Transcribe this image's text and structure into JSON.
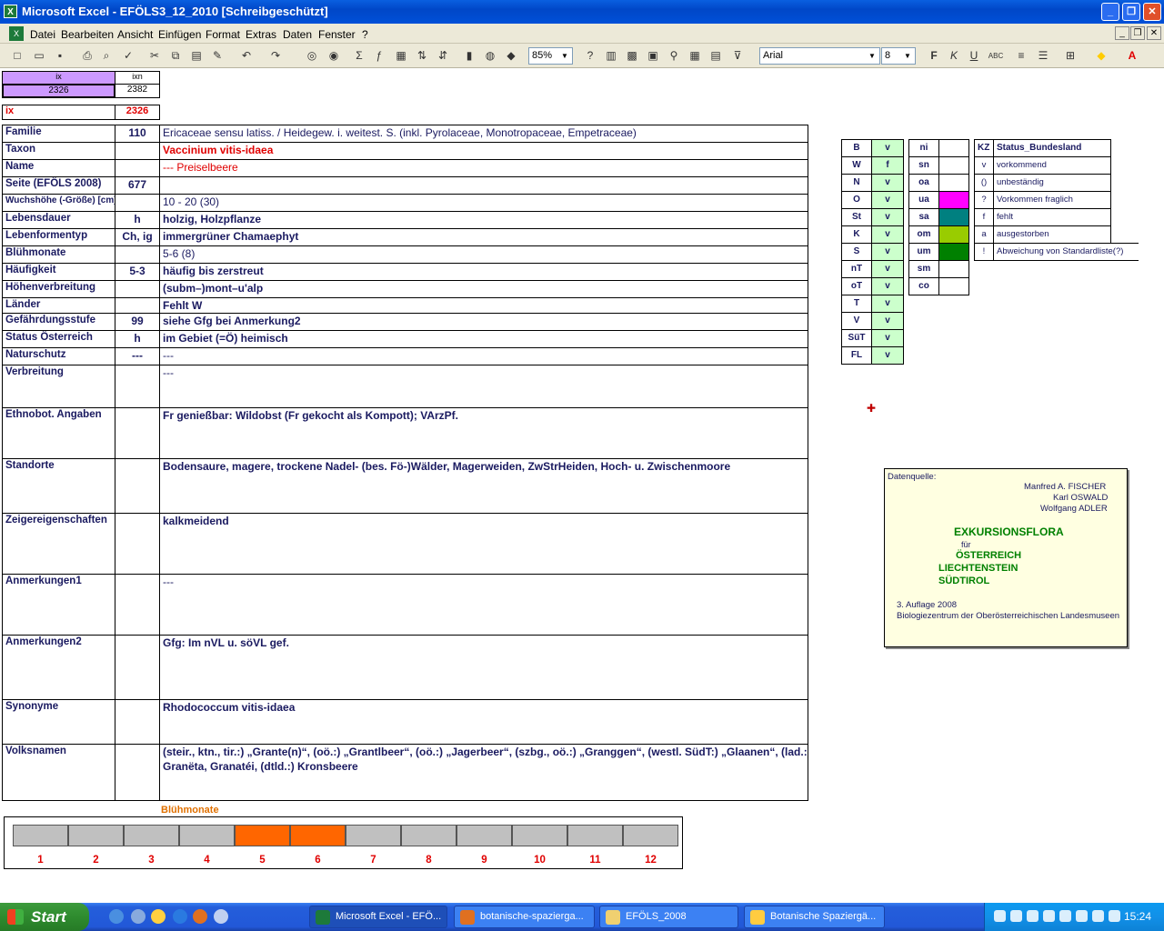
{
  "window": {
    "title": "Microsoft Excel - EFÖLS3_12_2010  [Schreibgeschützt]"
  },
  "menu": [
    "Datei",
    "Bearbeiten",
    "Ansicht",
    "Einfügen",
    "Format",
    "Extras",
    "Daten",
    "Fenster",
    "?"
  ],
  "toolbar": {
    "zoom": "85%",
    "font": "Arial",
    "size": "8"
  },
  "index": {
    "ix_header": "ix",
    "ixn_header": "ixn",
    "ix_value": "2326",
    "ixn_value": "2382",
    "ix_label": "ix",
    "ix_label_value": "2326"
  },
  "rows": [
    {
      "label": "Familie",
      "code": "110",
      "value": "Ericaceae sensu latiss.  /  Heidegew. i. weitest. S. (inkl. Pyrolaceae, Monotropaceae, Empetraceae)"
    },
    {
      "label": "Taxon",
      "code": "",
      "value": "Vaccinium vitis-idaea"
    },
    {
      "label": "Name",
      "code": "",
      "value": "--- Preiselbeere"
    },
    {
      "label": "Seite (EFÖLS 2008)",
      "code": "677",
      "value": ""
    },
    {
      "label": "Wuchshöhe (-Größe) [cm]",
      "code": "",
      "value": "10 - 20 (30)"
    },
    {
      "label": "Lebensdauer",
      "code": "h",
      "value": "holzig, Holzpflanze"
    },
    {
      "label": "Lebenformentyp",
      "code": "Ch, ig",
      "value": "immergrüner Chamaephyt"
    },
    {
      "label": "Blühmonate",
      "code": "",
      "value": "5-6 (8)"
    },
    {
      "label": "Häufigkeit",
      "code": "5-3",
      "value": "häufig bis zerstreut"
    },
    {
      "label": "Höhenverbreitung",
      "code": "",
      "value": "(subm–)mont–u'alp"
    },
    {
      "label": "Länder",
      "code": "",
      "value": "Fehlt W"
    },
    {
      "label": "Gefährdungsstufe",
      "code": "99",
      "value": "siehe Gfg bei Anmerkung2"
    },
    {
      "label": "Status Österreich",
      "code": "h",
      "value": "im Gebiet (=Ö) heimisch"
    },
    {
      "label": "Naturschutz",
      "code": "---",
      "value": "---"
    },
    {
      "label": "Verbreitung",
      "code": "",
      "value": "---"
    },
    {
      "label": "Ethnobot. Angaben",
      "code": "",
      "value": "Fr genießbar: Wildobst (Fr gekocht als Kompott); VArzPf."
    },
    {
      "label": "Standorte",
      "code": "",
      "value": "Bodensaure, magere, trockene Nadel- (bes. Fö-)Wälder, Magerweiden, ZwStrHeiden, Hoch- u. Zwischenmoore"
    },
    {
      "label": "Zeigereigenschaften",
      "code": "",
      "value": "kalkmeidend"
    },
    {
      "label": "Anmerkungen1",
      "code": "",
      "value": "---"
    },
    {
      "label": "Anmerkungen2",
      "code": "",
      "value": "Gfg:  Im nVL u. söVL gef."
    },
    {
      "label": "Synonyme",
      "code": "",
      "value": "Rhodococcum vitis-idaea"
    },
    {
      "label": "Volksnamen",
      "code": "",
      "value": "(steir., ktn., tir.:) „Grante(n)“, (oö.:) „Grantlbeer“, (oö.:) „Jagerbeer“,   (szbg., oö.:) „Granggen“, (westl. SüdT:) „Glaanen“, (lad.:)",
      "value2": "Granëta, Granatéi, (dtld.:) Kronsbeere"
    }
  ],
  "states": [
    {
      "k": "B",
      "v": "v"
    },
    {
      "k": "W",
      "v": "f"
    },
    {
      "k": "N",
      "v": "v"
    },
    {
      "k": "O",
      "v": "v"
    },
    {
      "k": "St",
      "v": "v"
    },
    {
      "k": "K",
      "v": "v"
    },
    {
      "k": "S",
      "v": "v"
    },
    {
      "k": "nT",
      "v": "v"
    },
    {
      "k": "oT",
      "v": "v"
    },
    {
      "k": "T",
      "v": "v"
    },
    {
      "k": "V",
      "v": "v"
    },
    {
      "k": "SüT",
      "v": "v"
    },
    {
      "k": "FL",
      "v": "v"
    }
  ],
  "zones": [
    {
      "k": "ni",
      "color": "#ffffff"
    },
    {
      "k": "sn",
      "color": "#ffffff"
    },
    {
      "k": "oa",
      "color": "#ffffff"
    },
    {
      "k": "ua",
      "color": "#ff00ff"
    },
    {
      "k": "sa",
      "color": "#008080"
    },
    {
      "k": "om",
      "color": "#99cc00"
    },
    {
      "k": "um",
      "color": "#008000"
    },
    {
      "k": "sm",
      "color": "#ffffff"
    },
    {
      "k": "co",
      "color": "#ffffff"
    }
  ],
  "legend": {
    "kz": "KZ",
    "title": "Status_Bundesland",
    "items": [
      {
        "k": "v",
        "t": "vorkommend"
      },
      {
        "k": "()",
        "t": "unbeständig"
      },
      {
        "k": "?",
        "t": "Vorkommen fraglich"
      },
      {
        "k": "f",
        "t": "fehlt"
      },
      {
        "k": "a",
        "t": "ausgestorben"
      },
      {
        "k": "!",
        "t": "Abweichung von Standardliste(?)"
      }
    ]
  },
  "note": {
    "source": "Datenquelle:",
    "authors": [
      "Manfred A. FISCHER",
      "Karl OSWALD",
      "Wolfgang ADLER"
    ],
    "book": "EXKURSIONSFLORA",
    "fuer": "für",
    "regions": [
      "ÖSTERREICH",
      "LIECHTENSTEIN",
      "SÜDTIROL"
    ],
    "edition": "3. Auflage 2008",
    "publisher": "Biologiezentrum der Oberösterreichischen Landesmuseen"
  },
  "bloom": {
    "title": "Blühmonate",
    "months": [
      "1",
      "2",
      "3",
      "4",
      "5",
      "6",
      "7",
      "8",
      "9",
      "10",
      "11",
      "12"
    ],
    "active": [
      5,
      6
    ]
  },
  "taskbar": {
    "start": "Start",
    "tasks": [
      "Microsoft Excel - EFÖ...",
      "botanische-spazierga...",
      "EFÖLS_2008",
      "Botanische Spaziergä..."
    ],
    "clock": "15:24"
  }
}
